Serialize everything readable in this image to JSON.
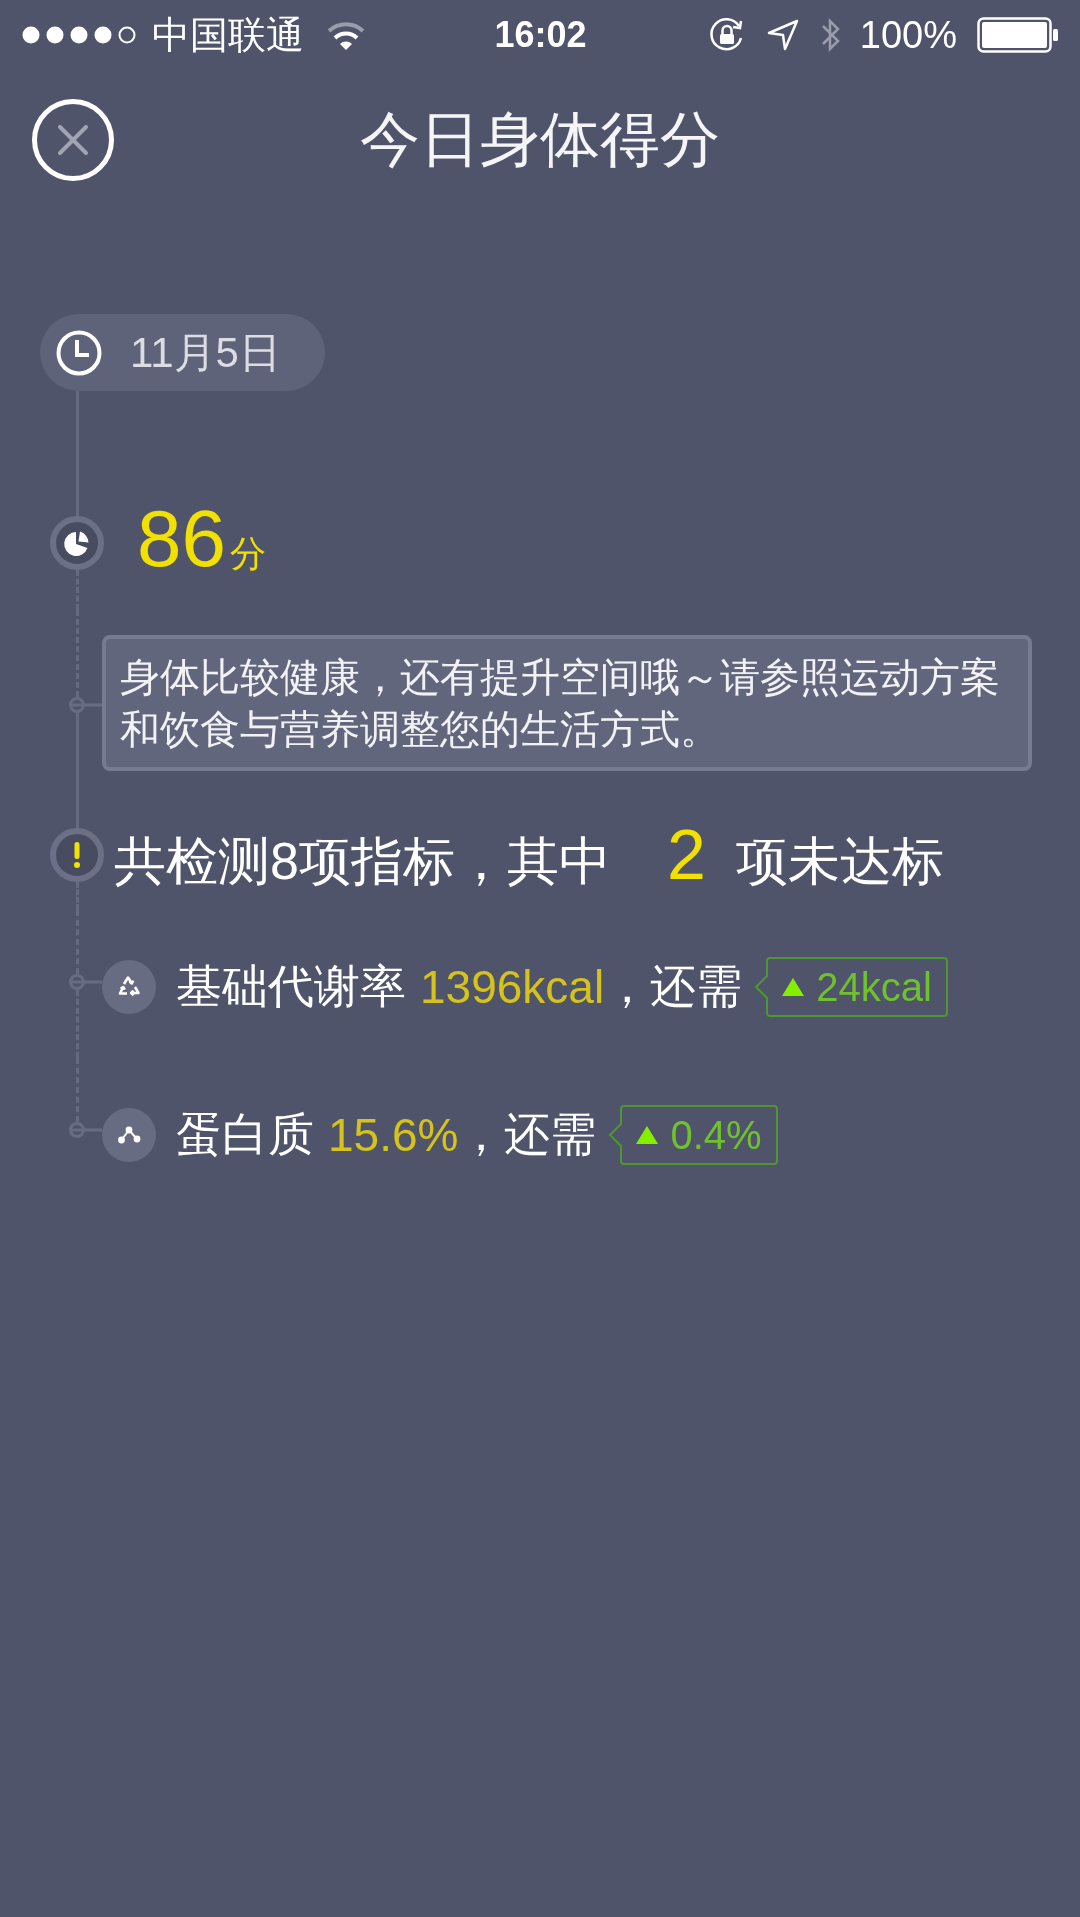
{
  "status_bar": {
    "carrier": "中国联通",
    "time": "16:02",
    "battery": "100%"
  },
  "header": {
    "title": "今日身体得分"
  },
  "timeline": {
    "date": "11月5日",
    "score": {
      "value": "86",
      "unit": "分"
    },
    "comment": "身体比较健康，还有提升空间哦～请参照运动方案和饮食与营养调整您的生活方式。",
    "summary": {
      "text_before": "共检测8项指标，其中",
      "failed_count": "2",
      "text_after": "项未达标"
    },
    "indicators": [
      {
        "kind": "metabolism",
        "name": "基础代谢率",
        "value": "1396kcal",
        "need_label": "，还需",
        "need": "24kcal"
      },
      {
        "kind": "protein",
        "name": "蛋白质",
        "value": "15.6%",
        "need_label": "，还需",
        "need": "0.4%"
      }
    ]
  }
}
